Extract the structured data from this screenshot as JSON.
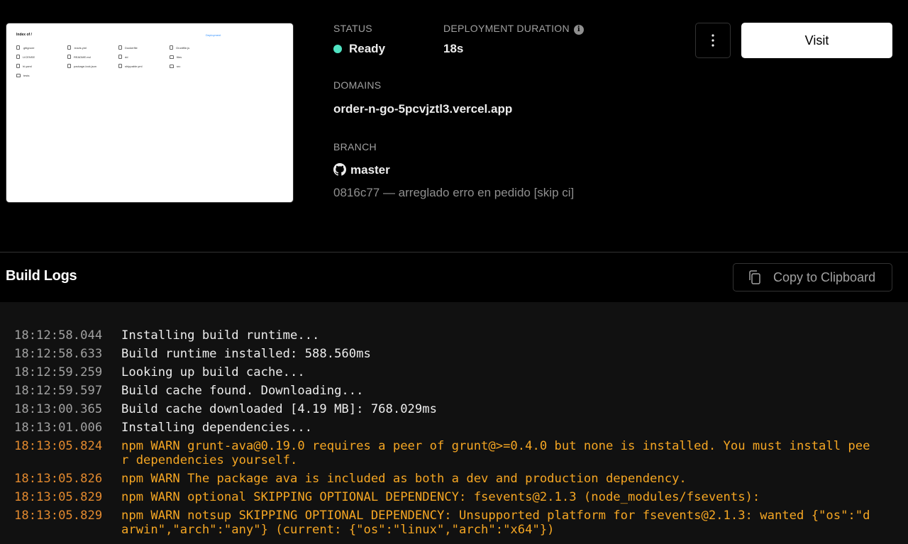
{
  "preview": {
    "title": "Index of /",
    "link": "Deployment",
    "files": [
      {
        "name": ".gitignore",
        "type": "file"
      },
      {
        "name": ".travis.yml",
        "type": "file"
      },
      {
        "name": "Dockerfile",
        "type": "file"
      },
      {
        "name": "Gruntfile.js",
        "type": "file"
      },
      {
        "name": "LICENSE",
        "type": "file"
      },
      {
        "name": "README.md",
        "type": "file"
      },
      {
        "name": "dd",
        "type": "file"
      },
      {
        "name": "files",
        "type": "folder"
      },
      {
        "name": "hi.yaml",
        "type": "file"
      },
      {
        "name": "package-lock.json",
        "type": "file"
      },
      {
        "name": "shippable.yml",
        "type": "file"
      },
      {
        "name": "src",
        "type": "folder"
      },
      {
        "name": "tests",
        "type": "folder"
      }
    ]
  },
  "status": {
    "label": "STATUS",
    "value": "Ready",
    "color": "#50e3c2"
  },
  "duration": {
    "label": "DEPLOYMENT DURATION",
    "value": "18s",
    "icon": "info-icon"
  },
  "domains": {
    "label": "DOMAINS",
    "value": "order-n-go-5pcvjztl3.vercel.app"
  },
  "branch": {
    "label": "BRANCH",
    "name": "master",
    "icon": "github-icon",
    "commit": "0816c77 — arreglado erro en pedido [skip ci]"
  },
  "actions": {
    "more_icon": "vertical-dots-icon",
    "visit_label": "Visit"
  },
  "build_logs": {
    "title": "Build Logs",
    "copy_label": "Copy to Clipboard",
    "copy_icon": "copy-icon",
    "warn_color": "#f5a623",
    "lines": [
      {
        "ts": "18:12:58.044",
        "msg": "Installing build runtime...",
        "level": "info"
      },
      {
        "ts": "18:12:58.633",
        "msg": "Build runtime installed: 588.560ms",
        "level": "info"
      },
      {
        "ts": "18:12:59.259",
        "msg": "Looking up build cache...",
        "level": "info"
      },
      {
        "ts": "18:12:59.597",
        "msg": "Build cache found. Downloading...",
        "level": "info"
      },
      {
        "ts": "18:13:00.365",
        "msg": "Build cache downloaded [4.19 MB]: 768.029ms",
        "level": "info"
      },
      {
        "ts": "18:13:01.006",
        "msg": "Installing dependencies...",
        "level": "info"
      },
      {
        "ts": "18:13:05.824",
        "msg": "npm WARN grunt-ava@0.19.0 requires a peer of grunt@>=0.4.0 but none is installed. You must install peer dependencies yourself.",
        "level": "warn"
      },
      {
        "ts": "18:13:05.826",
        "msg": "npm WARN The package ava is included as both a dev and production dependency.",
        "level": "warn"
      },
      {
        "ts": "18:13:05.829",
        "msg": "npm WARN optional SKIPPING OPTIONAL DEPENDENCY: fsevents@2.1.3 (node_modules/fsevents):",
        "level": "warn"
      },
      {
        "ts": "18:13:05.829",
        "msg": "npm WARN notsup SKIPPING OPTIONAL DEPENDENCY: Unsupported platform for fsevents@2.1.3: wanted {\"os\":\"darwin\",\"arch\":\"any\"} (current: {\"os\":\"linux\",\"arch\":\"x64\"})",
        "level": "warn"
      }
    ]
  }
}
